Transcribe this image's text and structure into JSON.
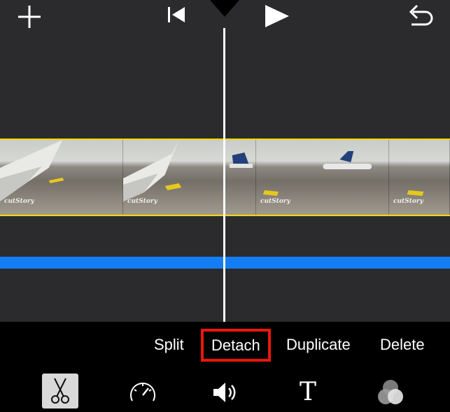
{
  "toolbar_icons": [
    "add-icon",
    "skip-back-icon",
    "play-icon",
    "undo-icon"
  ],
  "clip": {
    "watermark": "cutStory",
    "accent_color": "#f2d60a"
  },
  "audio_track_color": "#147df2",
  "actions": {
    "split_label": "Split",
    "detach_label": "Detach",
    "duplicate_label": "Duplicate",
    "delete_label": "Delete",
    "highlight_color": "#e9180b"
  },
  "tools": {
    "selected": "scissors-icon",
    "items": [
      "scissors-icon",
      "speedometer-icon",
      "volume-icon",
      "title-icon",
      "filters-icon"
    ],
    "title_glyph": "T"
  }
}
